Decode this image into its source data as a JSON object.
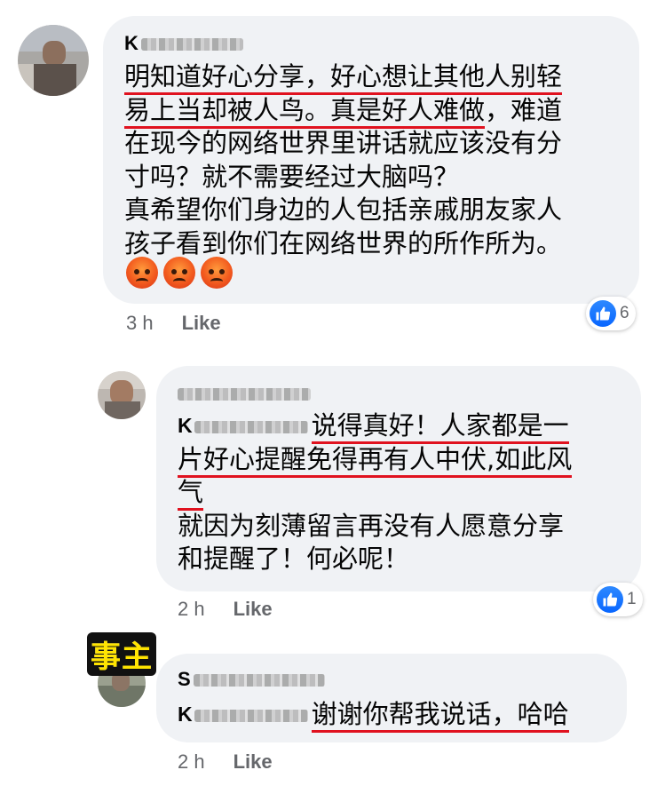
{
  "comments": [
    {
      "name_prefix": "K",
      "lines": [
        {
          "plain": "",
          "under": "明知道好心分享，好心想让其他人别轻"
        },
        {
          "plain": "",
          "under": "易上当却被人鸟。真是好人难做",
          "after": "，难道"
        },
        {
          "plain": "在现今的网络世界里讲话就应该没有分"
        },
        {
          "plain": "寸吗？就不需要经过大脑吗？"
        },
        {
          "plain": "真希望你们身边的人包括亲戚朋友家人"
        },
        {
          "plain": "孩子看到你们在网络世界的所作所为。"
        }
      ],
      "emojis": [
        "angry-face",
        "angry-face",
        "angry-face"
      ],
      "time": "3 h",
      "like": "Like",
      "reaction_count": "6"
    },
    {
      "tag_prefix": "K",
      "lines": [
        {
          "under": "说得真好！人家都是一"
        },
        {
          "under": "片好心提醒免得再有人中伏,如此风"
        },
        {
          "under": "气"
        },
        {
          "plain": "就因为刻薄留言再没有人愿意分享"
        },
        {
          "plain": "和提醒了！何必呢！"
        }
      ],
      "time": "2 h",
      "like": "Like",
      "reaction_count": "1"
    },
    {
      "name_prefix": "S",
      "tag_prefix": "K",
      "lines": [
        {
          "under": "谢谢你帮我说话，哈哈"
        }
      ],
      "time": "2 h",
      "like": "Like"
    }
  ],
  "sticker": "事主",
  "colors": {
    "underline": "#e0121f",
    "bubble": "#f0f2f5",
    "like_blue": "#0866ff",
    "meta": "#65676b"
  }
}
